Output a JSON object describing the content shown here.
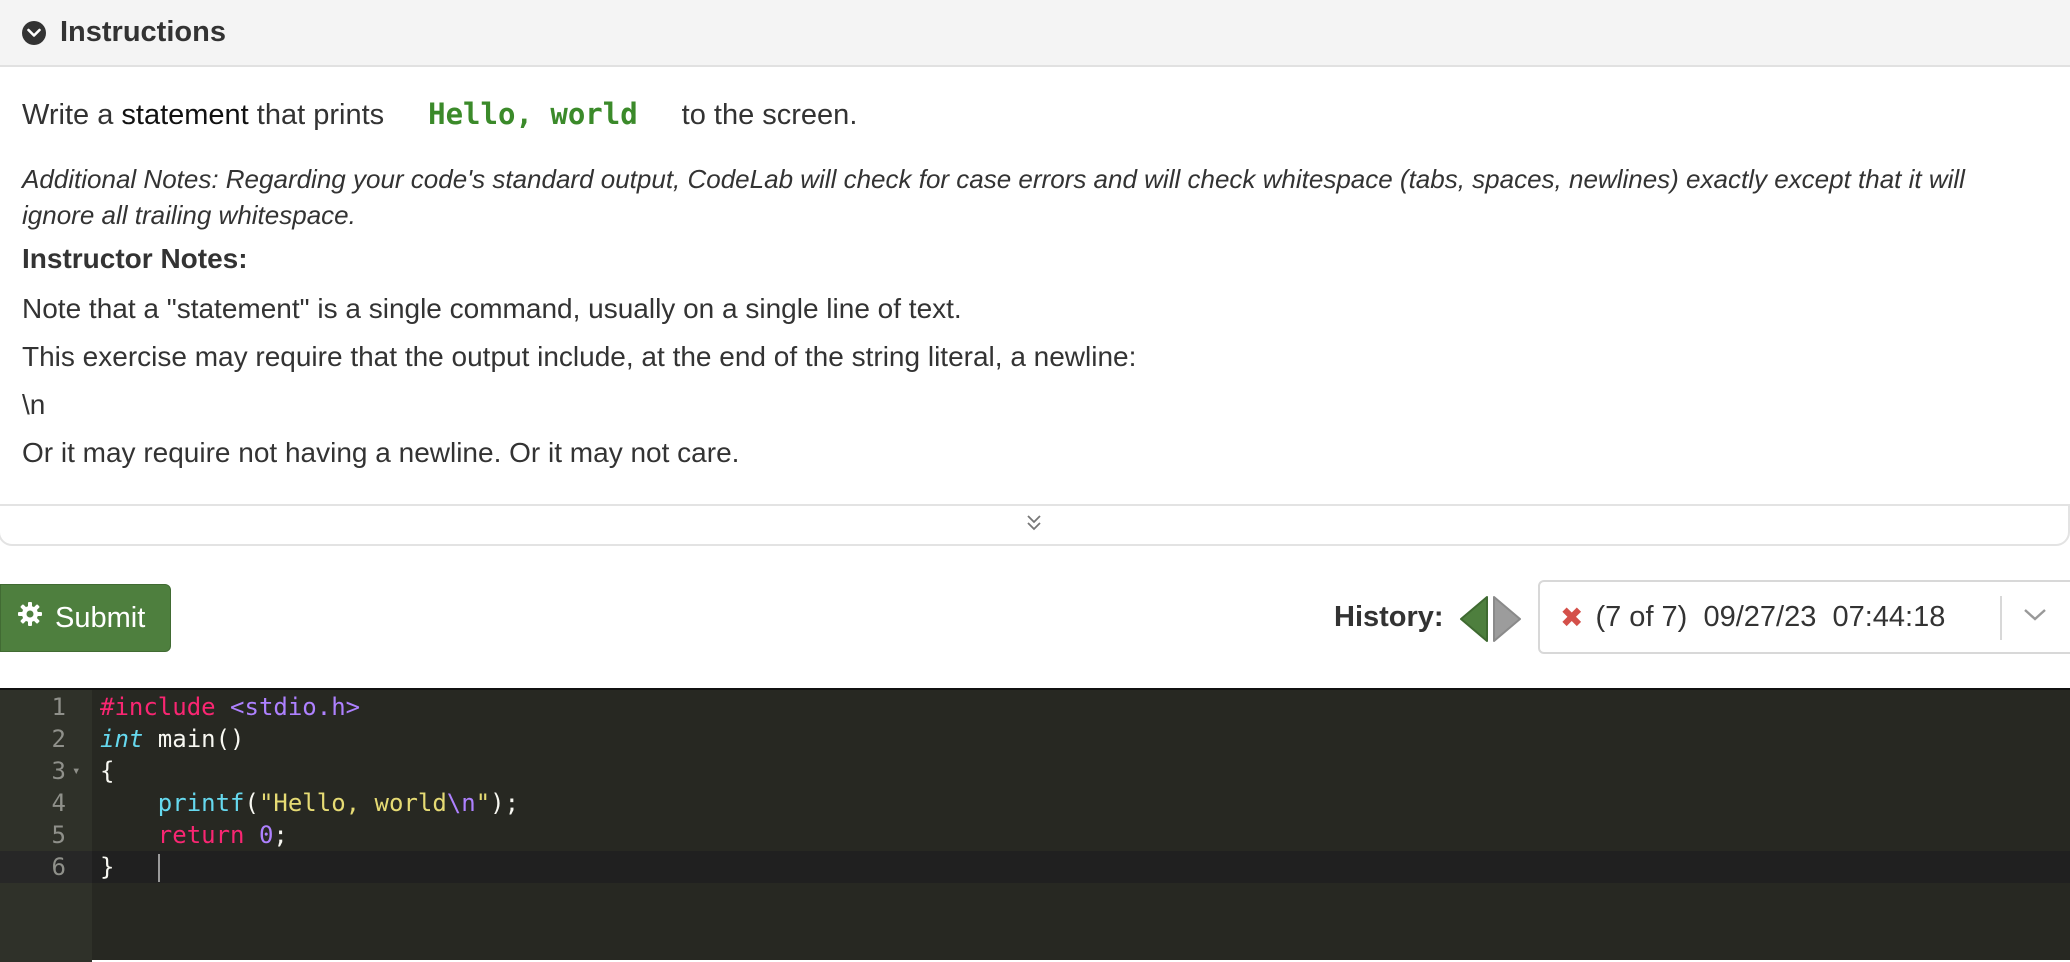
{
  "header": {
    "title": "Instructions",
    "toggle_icon": "chevron-down-circle-icon"
  },
  "instructions": {
    "line1_prefix": "Write a ",
    "line1_keyword": "statement",
    "line1_mid": " that prints",
    "line1_code": "Hello, world",
    "line1_suffix": "to the screen.",
    "code_color": "#3b8a2a",
    "additional_notes": "Additional Notes: Regarding your code's standard output, CodeLab will check for case errors and will check whitespace (tabs, spaces, newlines) exactly except that it will ignore all trailing whitespace.",
    "instructor_notes_label": "Instructor Notes:",
    "instructor_notes": [
      "Note that a \"statement\" is a single command, usually on a single line of text.",
      "This exercise may require that the output include, at the end of the string literal, a newline:",
      "\\n",
      "Or it may require not having a newline. Or it may not care."
    ]
  },
  "collapse_icon": "double-chevron-down-icon",
  "submit": {
    "label": "Submit",
    "icon": "gear-icon",
    "color": "#4e7f3e"
  },
  "history": {
    "label": "History:",
    "status_icon": "x-icon",
    "status_color": "#d4504a",
    "selected": "(7 of 7)  09/27/23  07:44:18"
  },
  "editor": {
    "theme": "monokai",
    "lines": [
      {
        "num": "1",
        "parts": [
          [
            "kw-inc",
            "#include "
          ],
          [
            "kw-hdr",
            "<stdio.h>"
          ]
        ]
      },
      {
        "num": "2",
        "parts": [
          [
            "kw-type",
            "int"
          ],
          [
            "",
            " main()"
          ]
        ]
      },
      {
        "num": "3",
        "parts": [
          [
            "",
            "{"
          ]
        ],
        "fold": true
      },
      {
        "num": "4",
        "parts": [
          [
            "",
            "    "
          ],
          [
            "kw-fn",
            "printf"
          ],
          [
            "",
            "("
          ],
          [
            "kw-str",
            "\"Hello, world"
          ],
          [
            "kw-esc",
            "\\n"
          ],
          [
            "kw-str",
            "\""
          ],
          [
            "",
            ");"
          ]
        ]
      },
      {
        "num": "5",
        "parts": [
          [
            "",
            "    "
          ],
          [
            "kw-ret",
            "return"
          ],
          [
            "",
            " "
          ],
          [
            "kw-num",
            "0"
          ],
          [
            "",
            ";"
          ]
        ]
      },
      {
        "num": "6",
        "parts": [
          [
            "",
            "}"
          ]
        ]
      }
    ]
  }
}
